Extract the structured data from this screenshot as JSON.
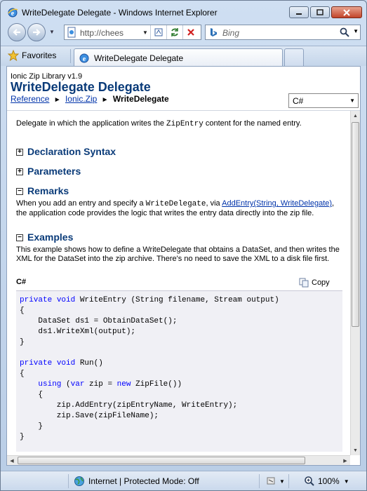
{
  "window": {
    "title": "WriteDelegate Delegate - Windows Internet Explorer"
  },
  "navbar": {
    "url": "http://chees",
    "search_placeholder": "Bing"
  },
  "tabs": {
    "favorites_label": "Favorites",
    "active_tab_label": "WriteDelegate Delegate"
  },
  "page": {
    "library": "Ionic Zip Library v1.9",
    "title": "WriteDelegate Delegate",
    "breadcrumb": {
      "item1": "Reference",
      "item2": "Ionic.Zip",
      "current": "WriteDelegate",
      "separator": "►"
    },
    "language_select": "C#",
    "intro_pre": "Delegate in which the application writes the ",
    "intro_code": "ZipEntry",
    "intro_post": " content for the named entry.",
    "sections": {
      "declaration": "Declaration Syntax",
      "parameters": "Parameters",
      "remarks": "Remarks",
      "examples": "Examples"
    },
    "remarks": {
      "pre": "When you add an entry and specify a ",
      "code": "WriteDelegate",
      "mid": ", via ",
      "link": "AddEntry(String, WriteDelegate)",
      "post": ", the application code provides the logic that writes the entry data directly into the zip file."
    },
    "examples_text": "This example shows how to define a WriteDelegate that obtains a DataSet, and then writes the XML for the DataSet into the zip archive. There's no need to save the XML to a disk file first.",
    "code_lang": "C#",
    "copy_label": "Copy"
  },
  "statusbar": {
    "zone": "Internet | Protected Mode: Off",
    "zoom": "100%"
  },
  "icons": {
    "ie": "ie-logo-icon",
    "back": "back-arrow-icon",
    "forward": "forward-arrow-icon",
    "refresh": "refresh-icon",
    "stop": "stop-icon",
    "favorites": "star-icon",
    "search": "magnifier-icon",
    "globe": "globe-icon",
    "copy": "copy-icon"
  }
}
